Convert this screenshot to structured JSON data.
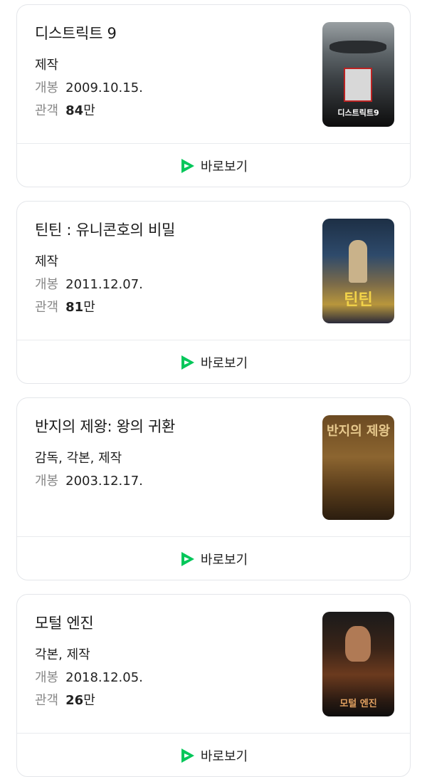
{
  "movies": [
    {
      "title": "디스트릭트 9",
      "role": "제작",
      "release_label": "개봉",
      "release": "2009.10.15.",
      "audience_label": "관객",
      "audience_num": "84",
      "audience_unit": "만",
      "poster_text": "디스트릭트9",
      "watch_label": "바로보기"
    },
    {
      "title": "틴틴 : 유니콘호의 비밀",
      "role": "제작",
      "release_label": "개봉",
      "release": "2011.12.07.",
      "audience_label": "관객",
      "audience_num": "81",
      "audience_unit": "만",
      "poster_text": "틴틴",
      "watch_label": "바로보기"
    },
    {
      "title": "반지의 제왕: 왕의 귀환",
      "role": "감독, 각본, 제작",
      "release_label": "개봉",
      "release": "2003.12.17.",
      "poster_text": "반지의 제왕",
      "watch_label": "바로보기"
    },
    {
      "title": "모털 엔진",
      "role": "각본, 제작",
      "release_label": "개봉",
      "release": "2018.12.05.",
      "audience_label": "관객",
      "audience_num": "26",
      "audience_unit": "만",
      "poster_text": "모털 엔진",
      "watch_label": "바로보기"
    }
  ],
  "colors": {
    "accent": "#03c75a",
    "accent_dark": "#0a9f48"
  }
}
